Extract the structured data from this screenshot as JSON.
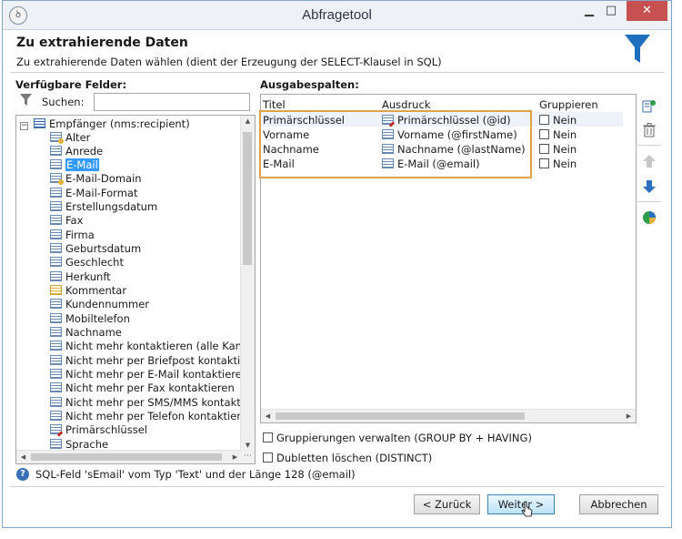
{
  "window": {
    "title": "Abfragetool",
    "minimize": "▁",
    "maximize": "□",
    "close": "✕"
  },
  "header": {
    "title": "Zu extrahierende Daten",
    "subtitle": "Zu extrahierende Daten wählen (dient der Erzeugung der SELECT-Klausel in SQL)"
  },
  "left": {
    "label": "Verfügbare Felder:",
    "search_label": "Suchen:",
    "search_value": "",
    "root": "Empfänger (nms:recipient)",
    "items": [
      "Alter",
      "Anrede",
      "E-Mail",
      "E-Mail-Domain",
      "E-Mail-Format",
      "Erstellungsdatum",
      "Fax",
      "Firma",
      "Geburtsdatum",
      "Geschlecht",
      "Herkunft",
      "Kommentar",
      "Kundennummer",
      "Mobiltelefon",
      "Nachname",
      "Nicht mehr kontaktieren (alle Kanäle)",
      "Nicht mehr per Briefpost kontaktieren",
      "Nicht mehr per E-Mail kontaktieren",
      "Nicht mehr per Fax kontaktieren",
      "Nicht mehr per SMS/MMS kontaktieren",
      "Nicht mehr per Telefon kontaktieren",
      "Primärschlüssel",
      "Sprache"
    ],
    "selected": "E-Mail"
  },
  "right": {
    "label": "Ausgabespalten:",
    "columns": [
      "Titel",
      "Ausdruck",
      "Gruppieren"
    ],
    "rows": [
      {
        "title": "Primärschlüssel",
        "expr": "Primärschlüssel (@id)",
        "group": "Nein"
      },
      {
        "title": "Vorname",
        "expr": "Vorname (@firstName)",
        "group": "Nein"
      },
      {
        "title": "Nachname",
        "expr": "Nachname (@lastName)",
        "group": "Nein"
      },
      {
        "title": "E-Mail",
        "expr": "E-Mail (@email)",
        "group": "Nein"
      }
    ]
  },
  "options": {
    "group_by": "Gruppierungen verwalten (GROUP BY + HAVING)",
    "distinct": "Dubletten löschen (DISTINCT)"
  },
  "help_text": "SQL-Feld 'sEmail' vom Typ 'Text' und der Länge 128 (@email)",
  "buttons": {
    "back": "< Zurück",
    "next": "Weiter >",
    "cancel": "Abbrechen"
  },
  "colors": {
    "accent": "#3399ff",
    "highlight": "#e1a14a",
    "funnel": "#1f6fbf"
  }
}
